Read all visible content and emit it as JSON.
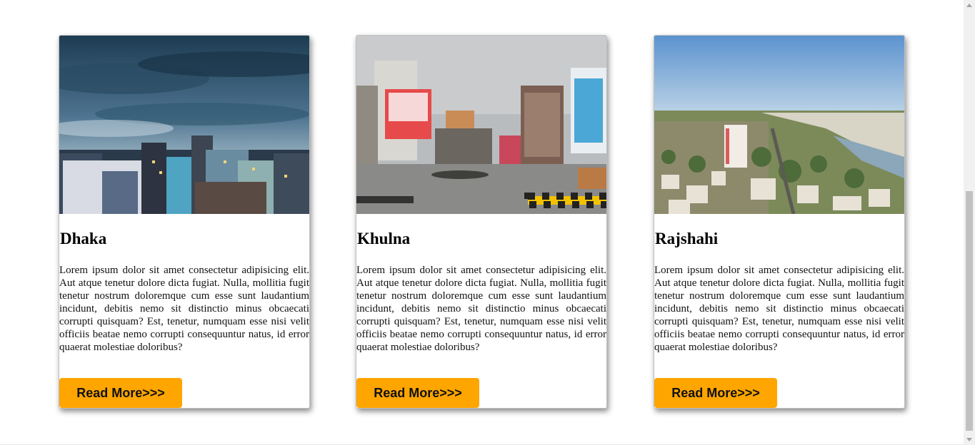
{
  "cards": [
    {
      "title": "Dhaka",
      "body": "Lorem ipsum dolor sit amet consectetur adipisicing elit. Aut atque tenetur dolore dicta fugiat. Nulla, mollitia fugit tenetur nostrum doloremque cum esse sunt laudantium incidunt, debitis nemo sit distinctio minus obcaecati corrupti quisquam? Est, tenetur, numquam esse nisi velit officiis beatae nemo corrupti consequuntur natus, id error quaerat molestiae doloribus?",
      "button": "Read More>>>"
    },
    {
      "title": "Khulna",
      "body": "Lorem ipsum dolor sit amet consectetur adipisicing elit. Aut atque tenetur dolore dicta fugiat. Nulla, mollitia fugit tenetur nostrum doloremque cum esse sunt laudantium incidunt, debitis nemo sit distinctio minus obcaecati corrupti quisquam? Est, tenetur, numquam esse nisi velit officiis beatae nemo corrupti consequuntur natus, id error quaerat molestiae doloribus?",
      "button": "Read More>>>"
    },
    {
      "title": "Rajshahi",
      "body": "Lorem ipsum dolor sit amet consectetur adipisicing elit. Aut atque tenetur dolore dicta fugiat. Nulla, mollitia fugit tenetur nostrum doloremque cum esse sunt laudantium incidunt, debitis nemo sit distinctio minus obcaecati corrupti quisquam? Est, tenetur, numquam esse nisi velit officiis beatae nemo corrupti consequuntur natus, id error quaerat molestiae doloribus?",
      "button": "Read More>>>"
    }
  ],
  "colors": {
    "button_bg": "#ffa500",
    "card_border": "#bfbfbf"
  }
}
